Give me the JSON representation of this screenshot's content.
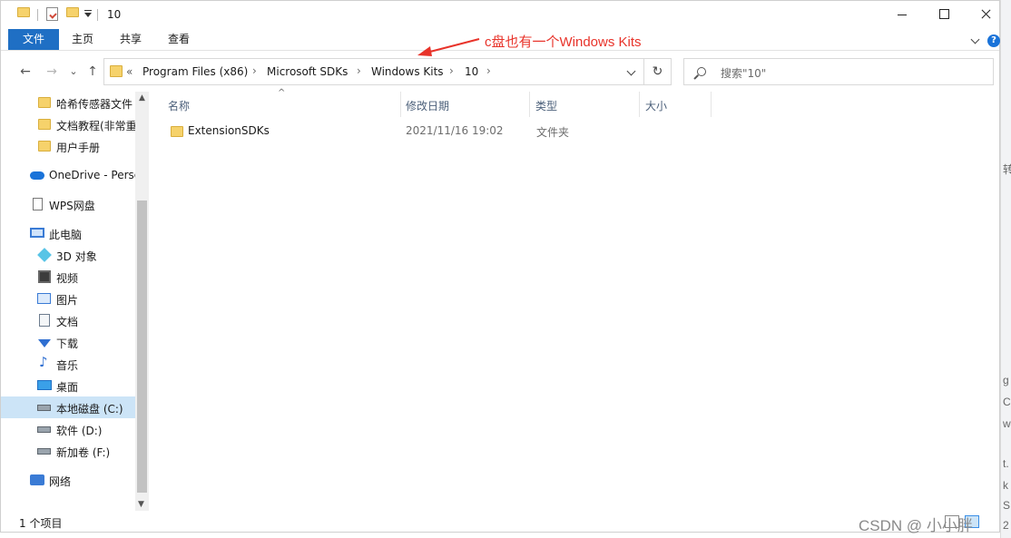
{
  "window": {
    "title": "10",
    "quick_access": [
      "folder-icon",
      "properties-icon",
      "new-folder-icon"
    ]
  },
  "ribbon": {
    "tabs": [
      {
        "label": "文件",
        "active": true
      },
      {
        "label": "主页"
      },
      {
        "label": "共享"
      },
      {
        "label": "查看"
      }
    ],
    "help": "?"
  },
  "annotation": {
    "text": "c盘也有一个Windows Kits",
    "color": "#e8332a"
  },
  "nav": {
    "back": "←",
    "forward": "→",
    "recent": "⌄",
    "up": "↑",
    "overflow": "«",
    "breadcrumbs": [
      "Program Files (x86)",
      "Microsoft SDKs",
      "Windows Kits",
      "10"
    ],
    "refresh": "↻",
    "search_placeholder": "搜索\"10\""
  },
  "sidebar": {
    "items": [
      {
        "label": "哈希传感器文件",
        "icon": "folder-icon"
      },
      {
        "label": "文档教程(非常重",
        "icon": "folder-icon"
      },
      {
        "label": "用户手册",
        "icon": "folder-icon"
      },
      {
        "label": "OneDrive - Perso",
        "icon": "onedrive-icon"
      },
      {
        "label": "WPS网盘",
        "icon": "wps-icon"
      },
      {
        "label": "此电脑",
        "icon": "computer-icon"
      },
      {
        "label": "3D 对象",
        "icon": "3d-objects-icon"
      },
      {
        "label": "视频",
        "icon": "video-icon"
      },
      {
        "label": "图片",
        "icon": "pictures-icon"
      },
      {
        "label": "文档",
        "icon": "documents-icon"
      },
      {
        "label": "下载",
        "icon": "download-icon"
      },
      {
        "label": "音乐",
        "icon": "music-icon"
      },
      {
        "label": "桌面",
        "icon": "desktop-icon"
      },
      {
        "label": "本地磁盘 (C:)",
        "icon": "drive-icon",
        "selected": true
      },
      {
        "label": "软件 (D:)",
        "icon": "drive-icon"
      },
      {
        "label": "新加卷 (F:)",
        "icon": "drive-icon"
      },
      {
        "label": "网络",
        "icon": "network-icon"
      }
    ]
  },
  "columns": [
    "名称",
    "修改日期",
    "类型",
    "大小"
  ],
  "files": [
    {
      "name": "ExtensionSDKs",
      "modified": "2021/11/16 19:02",
      "type": "文件夹",
      "size": ""
    }
  ],
  "status": {
    "item_count": "1 个项目"
  },
  "watermark": "CSDN @ 小小胖",
  "right_strip_chars": [
    "转",
    "g",
    "C",
    "w",
    "t.",
    "k",
    "S",
    "2"
  ],
  "colors": {
    "accent": "#1f6fc4",
    "selection": "#cce4f7",
    "folder": "#f6d26b"
  }
}
